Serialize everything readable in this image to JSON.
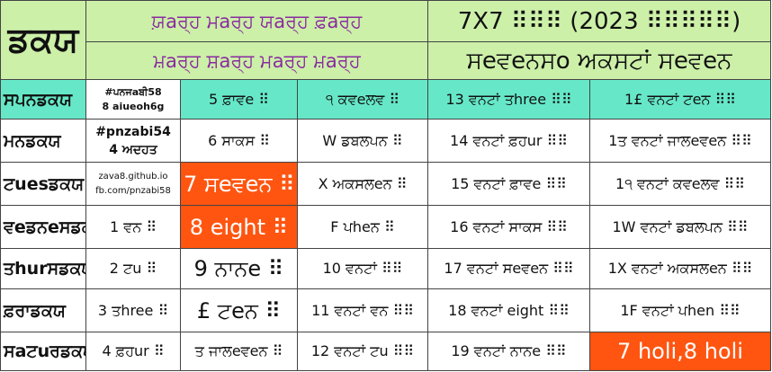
{
  "header": {
    "title": "ਡਕਯ",
    "months_line1": "ਯ਼aਰ੍ਹ ਮaਰ੍ਹ ਯaਰ੍ਹ ਫ਼aਰ੍ਹ",
    "months_line2": "ਮ਼aਰ੍ਹ ਸ਼aਰ੍ਹ ਮaਰ੍ਹ ਮ਼aਰ੍ਹ",
    "year_line": "7X7 ⠿⠿⠿ (2023 ⠿⠿⠿⠿⠿)",
    "days_line": "ਸeਵeਨਸo ਅਕਸਟਾਂ ਸeਵeਨ"
  },
  "rows": [
    {
      "day": "ਸਪਨਡਕਯ",
      "info": [
        "#ਪਨਜaਬੀ58",
        "8 aiueoh6g"
      ],
      "cells": [
        "5 ਫ਼ਾਵe ⠿",
        "੧ ਕਵeਲਵ ⠿",
        "13 ਵਨਟਾਂ ਤhree ⠿⠿",
        "1£ ਵਨਟਾਂ ਟeਨ ⠿⠿"
      ]
    },
    {
      "day": "ਮਨਡਕਯ",
      "info": [
        "#pnzabi54",
        "4 ਅਦਹਤ"
      ],
      "cells": [
        "6 ਸਾਕਸ ⠿",
        "W ਡਬਲਪਨ ⠿",
        "14 ਵਨਟਾਂ ਫ਼ਹur ⠿⠿",
        "1ਤ ਵਨਟਾਂ ਜਾਲeਵeਨ ⠿⠿"
      ]
    },
    {
      "day": "ਟuesਡਕਯ",
      "info": [
        "zava8.github.io",
        "fb.com/pnzabi58"
      ],
      "special": "7 ਸeਵeਨ ⠿",
      "cells": [
        "X ਅਕਸਲeਨ ⠿",
        "15 ਵਨਟਾਂ ਫ਼ਾਵe ⠿⠿",
        "1੧ ਵਨਟਾਂ ਕਵeਲਵ ⠿⠿"
      ]
    },
    {
      "day": "ਵeਡਨeਸਡਕਯ",
      "first": "1 ਵਨ ⠿",
      "special": "8 eight ⠿",
      "cells": [
        "F ਪheਨ ⠿",
        "16 ਵਨਟਾਂ ਸਾਕਸ ⠿⠿",
        "1W ਵਨਟਾਂ ਡਬਲਪਨ ⠿⠿"
      ]
    },
    {
      "day": "ਤhurਸਡਕਯ",
      "first": "2 ਟu ⠿",
      "big": "9 ਨਾਨe ⠿",
      "cells": [
        "10 ਵਨਟਾਂ ⠿⠿",
        "17 ਵਨਟਾਂ ਸeਵeਨ ⠿⠿",
        "1X ਵਨਟਾਂ ਅਕਸਲeਨ ⠿⠿"
      ]
    },
    {
      "day": "ਫ਼ਰਾਡਕਯ",
      "first": "3 ਤhree ⠿",
      "big": "£ ਟeਨ ⠿",
      "cells": [
        "11 ਵਨਟਾਂ ਵਨ ⠿⠿",
        "18 ਵਨਟਾਂ eight ⠿⠿",
        "1F ਵਨਟਾਂ ਪhen ⠿⠿"
      ]
    },
    {
      "day": "ਸaਟuਰਡਕਯ",
      "first": "4 ਫ਼ਹur ⠿",
      "cells": [
        "ਤ ਜਾਲeਵeਨ ⠿",
        "12 ਵਨਟਾਂ ਟu ⠿⠿",
        "19 ਵਨਟਾਂ ਨਾਨe ⠿⠿"
      ],
      "special": "7 holi,8 holi"
    }
  ],
  "colors": {
    "header_bg": "#ccf0a8",
    "row1_bg": "#66e8c8",
    "highlight": "#ff5511",
    "month_text": "#8a2aa0"
  }
}
